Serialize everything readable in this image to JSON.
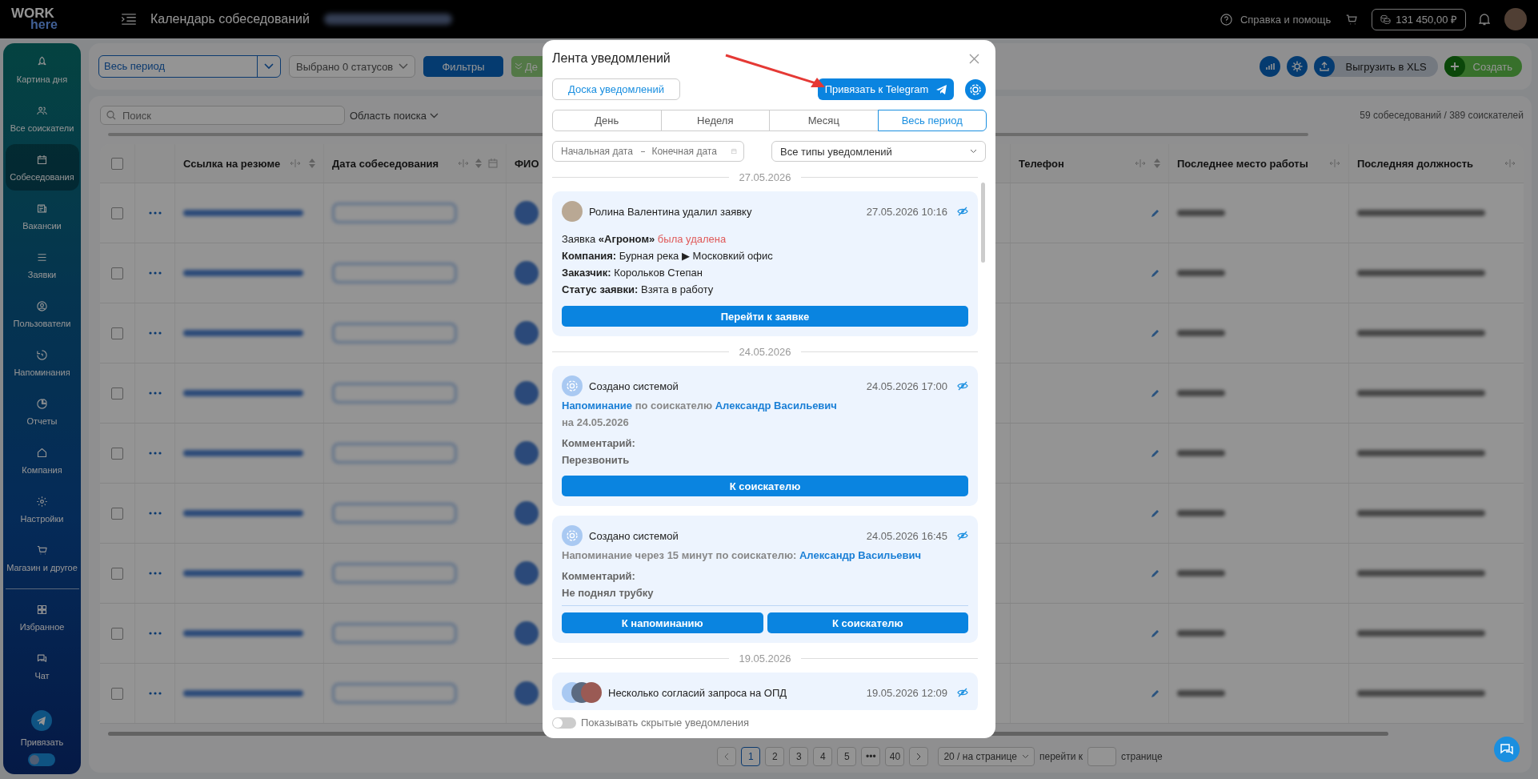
{
  "header": {
    "logo_top": "WORK",
    "logo_bottom": "here",
    "title": "Календарь собеседований",
    "help": "Справка и помощь",
    "balance": "131 450,00 ₽"
  },
  "sidebar": {
    "items": [
      {
        "label": "Картина дня",
        "selected": false
      },
      {
        "label": "Все соискатели",
        "selected": false
      },
      {
        "label": "Собеседования",
        "selected": true
      },
      {
        "label": "Вакансии",
        "selected": false
      },
      {
        "label": "Заявки",
        "selected": false
      },
      {
        "label": "Пользователи",
        "selected": false
      },
      {
        "label": "Напоминания",
        "selected": false
      },
      {
        "label": "Отчеты",
        "selected": false
      },
      {
        "label": "Компания",
        "selected": false
      },
      {
        "label": "Настройки",
        "selected": false
      },
      {
        "label": "Магазин и другое",
        "selected": false
      }
    ],
    "extra_items": [
      {
        "label": "Избранное",
        "selected": false
      },
      {
        "label": "Чат",
        "selected": false
      }
    ],
    "telegram_label": "Привязать",
    "toggle": {
      "on": false
    }
  },
  "toolbar": {
    "period": "Весь период",
    "statuses": "Выбрано 0 статусов",
    "filters": "Фильтры",
    "green_button": "Де",
    "export": "Выгрузить в XLS",
    "create": "Создать"
  },
  "search": {
    "placeholder": "Поиск",
    "scope": "Область поиска",
    "count": "59 собеседований / 389 соискателей"
  },
  "table": {
    "select_all": {
      "checked": false
    },
    "columns": [
      "Ссылка на резюме",
      "Дата собеседования",
      "ФИО",
      "Телефон",
      "Последнее место работы",
      "Последняя должность"
    ],
    "rows": [
      {
        "checked": false
      },
      {
        "checked": false
      },
      {
        "checked": false
      },
      {
        "checked": false
      },
      {
        "checked": false
      },
      {
        "checked": false
      },
      {
        "checked": false
      },
      {
        "checked": false
      },
      {
        "checked": false
      }
    ]
  },
  "pagination": {
    "pages": [
      {
        "label": "1",
        "selected": true
      },
      {
        "label": "2",
        "selected": false
      },
      {
        "label": "3",
        "selected": false
      },
      {
        "label": "4",
        "selected": false
      },
      {
        "label": "5",
        "selected": false
      },
      {
        "label": "•••",
        "selected": false
      },
      {
        "label": "40",
        "selected": false
      }
    ],
    "page_size": "20 / на странице",
    "goto_label": "перейти к",
    "goto_suffix": "странице"
  },
  "modal": {
    "title": "Лента уведомлений",
    "board_button": "Доска уведомлений",
    "telegram_button": "Привязать к Telegram",
    "tabs": [
      {
        "label": "День",
        "selected": false
      },
      {
        "label": "Неделя",
        "selected": false
      },
      {
        "label": "Месяц",
        "selected": false
      },
      {
        "label": "Весь период",
        "selected": true
      }
    ],
    "date_start": {
      "placeholder": "Начальная дата"
    },
    "date_end": {
      "placeholder": "Конечная дата"
    },
    "type_select": "Все типы уведомлений",
    "groups": [
      {
        "date": "27.05.2026",
        "items": [
          {
            "kind": "photo",
            "author": "Ролина Валентина удалил заявку",
            "time": "27.05.2026 10:16",
            "lines": [
              [
                {
                  "text": "Заявка ",
                  "kind": "plain"
                },
                {
                  "text": "«Агроном»",
                  "kind": "bold"
                },
                {
                  "text": " была удалена",
                  "kind": "danger"
                }
              ],
              [
                {
                  "text": "Компания:",
                  "kind": "bold"
                },
                {
                  "text": " Бурная река ▶ Московкий офис",
                  "kind": "plain"
                }
              ],
              [
                {
                  "text": "Заказчик:",
                  "kind": "bold"
                },
                {
                  "text": " Корольков Степан",
                  "kind": "plain"
                }
              ],
              [
                {
                  "text": "Статус заявки:",
                  "kind": "bold"
                },
                {
                  "text": " Взята в работу",
                  "kind": "plain"
                }
              ]
            ],
            "separated": false,
            "buttons": [
              "Перейти к заявке"
            ]
          }
        ]
      },
      {
        "date": "24.05.2026",
        "items": [
          {
            "kind": "system",
            "author": "Создано системой",
            "time": "24.05.2026 17:00",
            "lines": [
              [
                {
                  "text": "Напоминание",
                  "kind": "link"
                },
                {
                  "text": " по соискателю ",
                  "kind": "muted"
                },
                {
                  "text": "Александр Васильевич",
                  "kind": "link"
                }
              ],
              [
                {
                  "text": "на 24.05.2026",
                  "kind": "muted"
                }
              ]
            ],
            "comment_label": "Комментарий:",
            "comment": "Перезвонить",
            "separated": false,
            "buttons": [
              "К соискателю"
            ]
          },
          {
            "kind": "system",
            "author": "Создано системой",
            "time": "24.05.2026 16:45",
            "lines": [
              [
                {
                  "text": "Напоминание через 15 минут по соискателю: ",
                  "kind": "muted"
                },
                {
                  "text": "Александр Васильевич",
                  "kind": "link"
                }
              ]
            ],
            "comment_label": "Комментарий:",
            "comment": "Не поднял трубку",
            "separated": true,
            "buttons": [
              "К напоминанию",
              "К соискателю"
            ]
          }
        ]
      },
      {
        "date": "19.05.2026",
        "items": [
          {
            "kind": "group",
            "author": "Несколько согласий запроса на ОПД",
            "time": "19.05.2026 12:09"
          }
        ]
      }
    ],
    "show_hidden": {
      "label": "Показывать скрытые уведомления",
      "on": false
    }
  }
}
